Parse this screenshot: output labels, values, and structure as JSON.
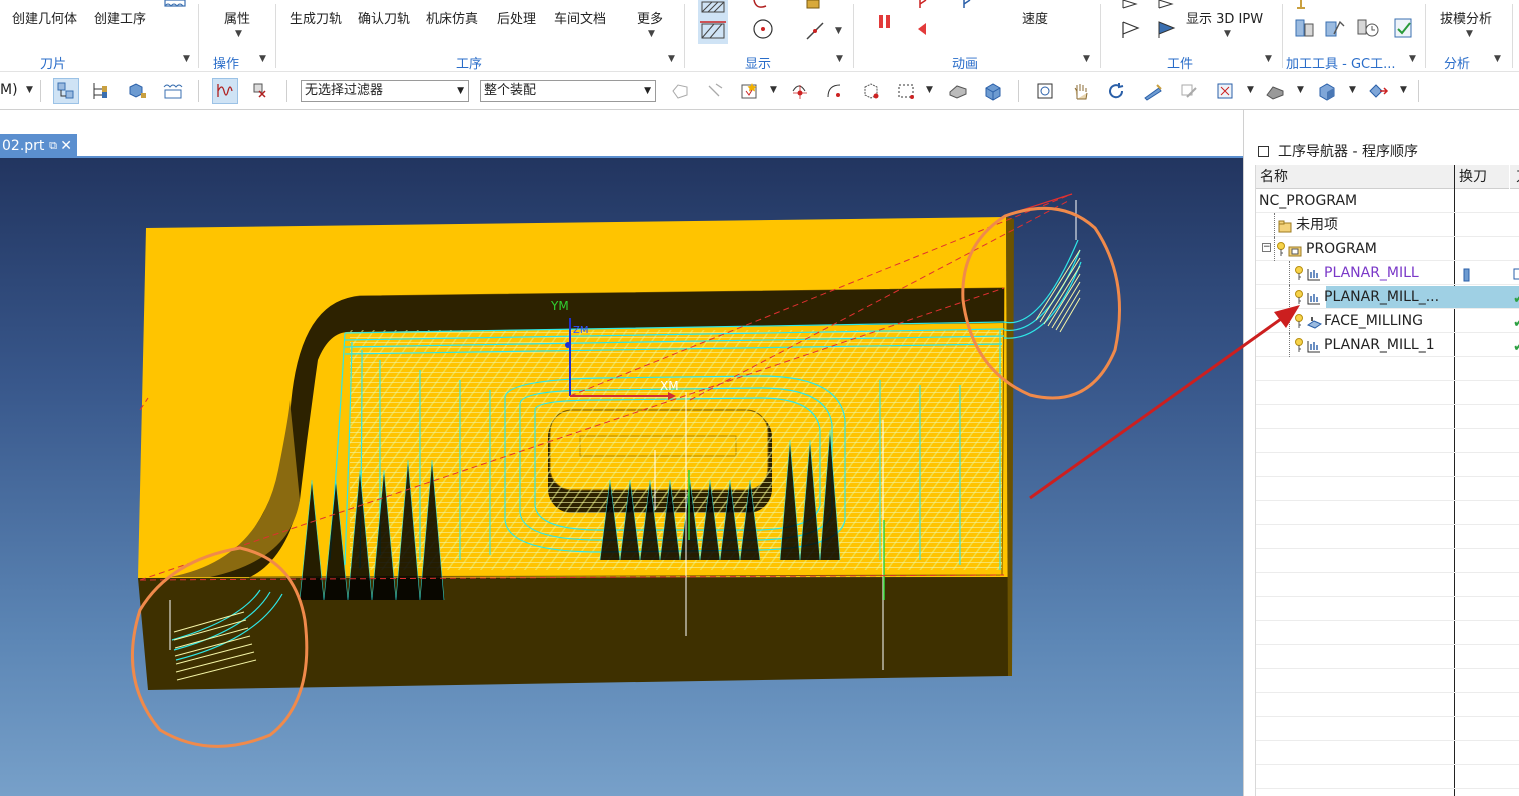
{
  "ribbon": {
    "buttons": {
      "create_geometry": "创建几何体",
      "create_operation": "创建工序",
      "properties": "属性",
      "generate_path": "生成刀轨",
      "verify_path": "确认刀轨",
      "machine_sim": "机床仿真",
      "postprocess": "后处理",
      "shop_doc": "车间文档",
      "more": "更多",
      "speed": "速度",
      "show_ipw": "显示 3D IPW",
      "draft_analysis": "拔模分析"
    },
    "groups": {
      "cutter": "刀片",
      "operation": "操作",
      "process": "工序",
      "display": "显示",
      "animation": "动画",
      "workpiece": "工件",
      "tools": "加工工具 - GC工...",
      "analysis": "分析"
    }
  },
  "toolbar": {
    "left_partial": "M)",
    "filter": "无选择过滤器",
    "assembly": "整个装配"
  },
  "file_tab": {
    "name": "02.prt"
  },
  "viewport": {
    "axis_y": "YM",
    "axis_x": "XM",
    "axis_z": "ZM",
    "colors": {
      "part": "#ffc400",
      "part_dark": "#3e3000",
      "toolpath": "#2ee7e7",
      "toolpath_yellow": "#f3f38c",
      "annotation_circle": "#f08a4b",
      "arrow": "#cc1f1f"
    }
  },
  "navigator": {
    "title": "工序导航器 - 程序顺序",
    "columns": [
      "名称",
      "换刀",
      "刀"
    ],
    "rows": [
      {
        "name": "NC_PROGRAM",
        "indent": 0,
        "color": "#222222",
        "icon": "none",
        "tool_change": false,
        "check": false
      },
      {
        "name": "未用项",
        "indent": 1,
        "color": "#222222",
        "icon": "folder-icon",
        "tool_change": false,
        "check": false
      },
      {
        "name": "PROGRAM",
        "indent": 1,
        "color": "#222222",
        "icon": "program-folder-icon",
        "tool_change": false,
        "check": false
      },
      {
        "name": "PLANAR_MILL",
        "indent": 2,
        "color": "#7a38c8",
        "icon": "planar-mill-icon",
        "tool_change": true,
        "check": false
      },
      {
        "name": "PLANAR_MILL_...",
        "indent": 2,
        "color": "#222222",
        "icon": "planar-mill-icon",
        "tool_change": false,
        "check": true,
        "selected": true
      },
      {
        "name": "FACE_MILLING",
        "indent": 2,
        "color": "#222222",
        "icon": "face-milling-icon",
        "tool_change": false,
        "check": true
      },
      {
        "name": "PLANAR_MILL_1",
        "indent": 2,
        "color": "#222222",
        "icon": "planar-mill-icon",
        "tool_change": false,
        "check": true
      }
    ]
  }
}
